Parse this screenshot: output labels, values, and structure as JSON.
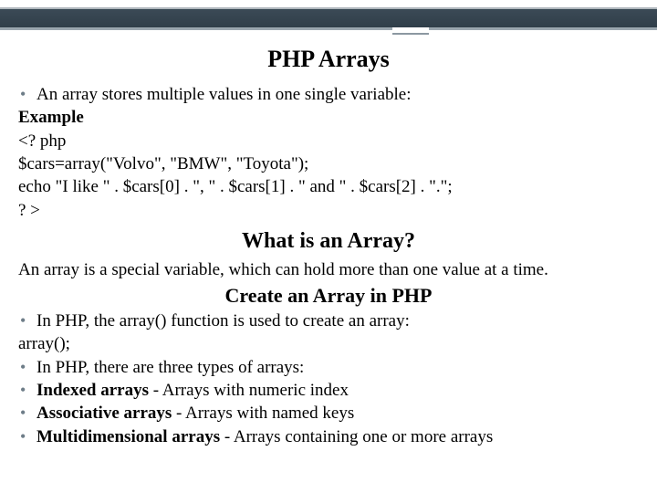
{
  "title": "PHP Arrays",
  "intro_bullet": "An array stores multiple values in one single variable:",
  "example_label": "Example",
  "code": {
    "l1": "<? php",
    "l2": "$cars=array(\"Volvo\", \"BMW\", \"Toyota\");",
    "l3": "echo \"I like \" . $cars[0] . \", \" . $cars[1] . \" and \" . $cars[2] . \".\";",
    "l4": "? >"
  },
  "section2_title": "What is an Array?",
  "section2_text": "An array is a special variable, which can hold more than one value at a time.",
  "section3_title": "Create an Array in PHP",
  "bullets2": {
    "b1": "In PHP, the array() function is used to create an array:",
    "array_call": "array();",
    "b2": "In PHP, there are three types of arrays:",
    "b3_bold": "Indexed arrays",
    "b3_rest": " - Arrays with numeric index",
    "b4_bold": "Associative arrays",
    "b4_rest": " - Arrays with named keys",
    "b5_bold": "Multidimensional arrays",
    "b5_rest": " - Arrays containing one or more arrays"
  }
}
